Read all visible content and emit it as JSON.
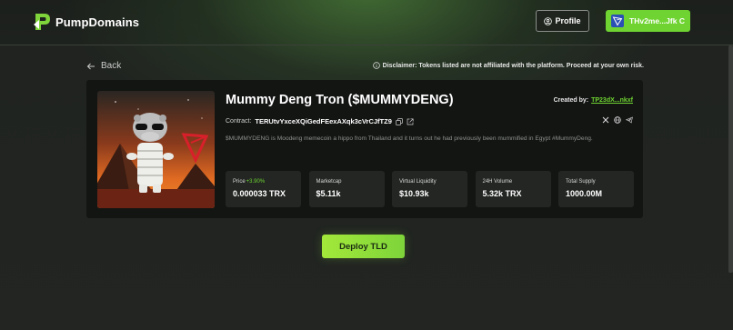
{
  "header": {
    "brand": "PumpDomains",
    "profile_label": "Profile",
    "wallet_label": "THv2me...Jfk C"
  },
  "nav": {
    "back_label": "Back",
    "disclaimer": "Disclaimer: Tokens listed are not affiliated with the platform. Proceed at your own risk."
  },
  "token": {
    "title": "Mummy Deng Tron ($MUMMYDENG)",
    "created_by_label": "Created by:",
    "creator": "TP23dX...nkxf",
    "contract_label": "Contract:",
    "contract": "TERUtvYxceXQiGedFEexAXqk3cVrCJfTZ9",
    "description": "$MUMMYDENG is Moodeng memecoin a hippo from Thailand and it turns out he had previously been mummified in Egypt #MummyDeng."
  },
  "stats": [
    {
      "label": "Price",
      "change": "+3.90%",
      "value": "0.000033 TRX"
    },
    {
      "label": "Marketcap",
      "change": "",
      "value": "$5.11k"
    },
    {
      "label": "Virtual Liquidity",
      "change": "",
      "value": "$10.93k"
    },
    {
      "label": "24H Volume",
      "change": "",
      "value": "5.32k TRX"
    },
    {
      "label": "Total Supply",
      "change": "",
      "value": "1000.00M"
    }
  ],
  "actions": {
    "deploy_label": "Deploy TLD"
  },
  "colors": {
    "accent": "#6fd431",
    "card": "#131513",
    "stat_bg": "#232623"
  },
  "icons": [
    "logo-icon",
    "user-circle-icon",
    "tron-wallet-icon",
    "arrow-left-icon",
    "info-circle-icon",
    "copy-icon",
    "external-link-icon",
    "x-icon",
    "globe-icon",
    "telegram-icon"
  ]
}
